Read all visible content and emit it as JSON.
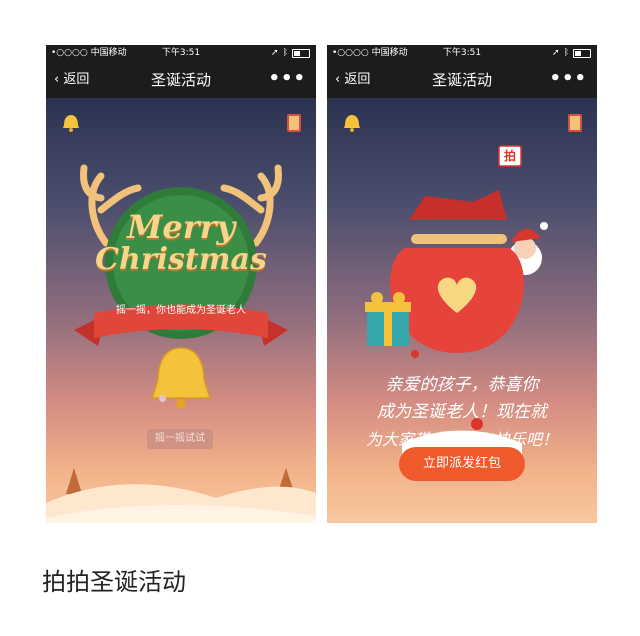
{
  "status_bar": {
    "carrier": "•○○○○ 中国移动",
    "time": "下午3:51"
  },
  "nav": {
    "back_label": "返回",
    "title": "圣诞活动",
    "more_label": "•••"
  },
  "left_screen": {
    "title_line1": "Merry",
    "title_line2": "Christmas",
    "ribbon_text": "摇一摇，你也能成为圣诞老人",
    "shake_button": "摇一摇试试"
  },
  "right_screen": {
    "tag_char": "拍",
    "greeting_lines": [
      "亲爱的孩子，恭喜你",
      "成为圣诞老人！现在就",
      "为大家带去希望与快乐吧！"
    ],
    "send_button": "立即派发红包"
  },
  "caption": "拍拍圣诞活动",
  "colors": {
    "nav_bg": "#1c1c1e",
    "accent_red": "#e0463a",
    "button_orange": "#ee5a2c",
    "gold": "#f4c33b"
  }
}
